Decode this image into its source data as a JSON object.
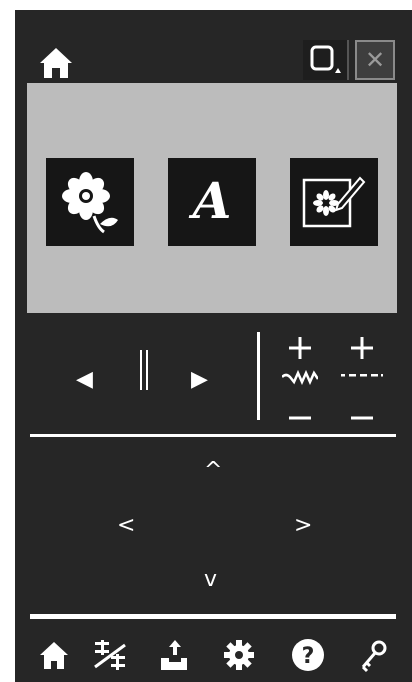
{
  "topbar": {
    "home_icon": "home-icon",
    "frame_icon": "hoop-frame-icon",
    "close_label": "✕"
  },
  "modes": [
    {
      "name": "embroidery-mode",
      "icon": "flower-icon"
    },
    {
      "name": "text-mode",
      "icon": "font-letter-icon",
      "letter": "A"
    },
    {
      "name": "edit-mode",
      "icon": "design-edit-icon"
    }
  ],
  "controls": {
    "back_label": "◀",
    "pause_label": "‖",
    "forward_label": "▶",
    "plus_label": "+",
    "minus_label": "−"
  },
  "navigation": {
    "up_label": "^",
    "left_label": "<",
    "right_label": ">",
    "down_label": "v"
  },
  "bottombar": {
    "icons": [
      "home-icon",
      "thread-icon",
      "export-icon",
      "settings-icon",
      "help-icon",
      "key-icon"
    ],
    "help_label": "?"
  },
  "colors": {
    "background": "#262626",
    "panel": "#bcbcbc",
    "tile": "#161616",
    "foreground": "#ffffff"
  }
}
